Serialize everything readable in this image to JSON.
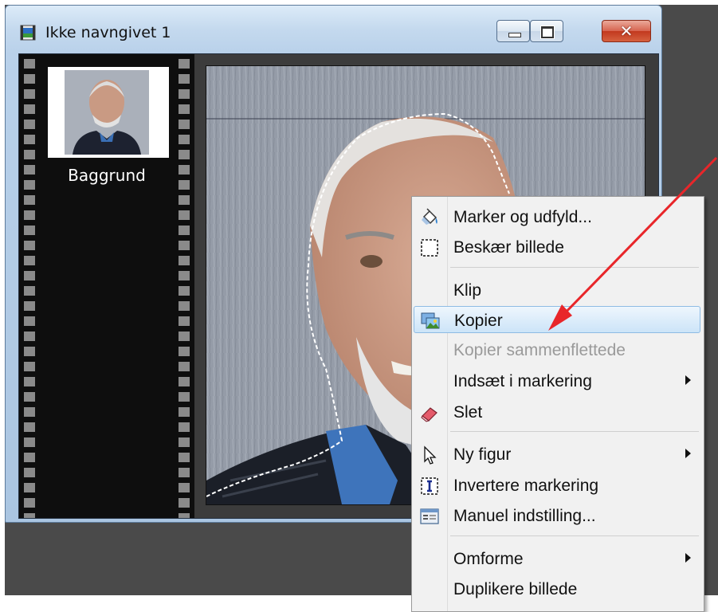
{
  "window": {
    "title": "Ikke navngivet 1",
    "icons": [
      "app-icon",
      "minimize-icon",
      "maximize-icon",
      "close-icon"
    ]
  },
  "layers": [
    {
      "label": "Baggrund"
    }
  ],
  "context_menu": {
    "items": [
      {
        "label": "Marker og udfyld...",
        "icon": "paint-bucket-icon",
        "enabled": true
      },
      {
        "label": "Beskær billede",
        "icon": "crop-icon",
        "enabled": true
      },
      {
        "label": "Klip",
        "enabled": true
      },
      {
        "label": "Kopier",
        "icon": "copy-image-icon",
        "enabled": true,
        "highlighted": true
      },
      {
        "label": "Kopier sammenflettede",
        "enabled": false
      },
      {
        "label": "Indsæt i markering",
        "enabled": true,
        "submenu": true
      },
      {
        "label": "Slet",
        "icon": "eraser-icon",
        "enabled": true
      },
      {
        "label": "Ny figur",
        "icon": "cursor-icon",
        "enabled": true,
        "submenu": true
      },
      {
        "label": "Invertere markering",
        "icon": "invert-selection-icon",
        "enabled": true
      },
      {
        "label": "Manuel indstilling...",
        "icon": "manual-settings-icon",
        "enabled": true
      },
      {
        "label": "Omforme",
        "enabled": true,
        "submenu": true
      },
      {
        "label": "Duplikere billede",
        "enabled": true
      }
    ]
  },
  "annotation": {
    "type": "arrow",
    "color": "#e8262a",
    "points_to": "Kopier"
  }
}
